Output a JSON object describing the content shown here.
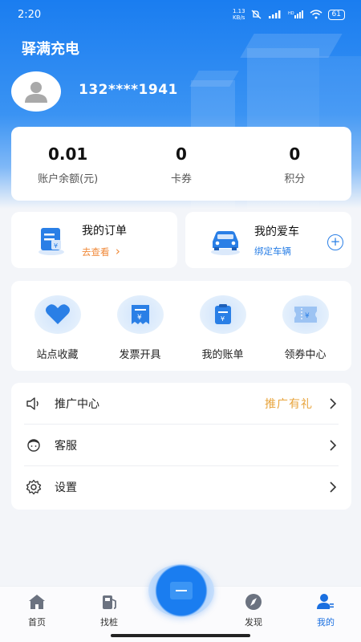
{
  "status_bar": {
    "time": "2:20",
    "net_speed_top": "1.13",
    "net_speed_bottom": "KB/s",
    "battery": "61"
  },
  "header": {
    "app_title": "驿满充电",
    "phone": "132****1941"
  },
  "stats": [
    {
      "value": "0.01",
      "label": "账户余额(元)"
    },
    {
      "value": "0",
      "label": "卡券"
    },
    {
      "value": "0",
      "label": "积分"
    }
  ],
  "quick_cards": {
    "orders": {
      "title": "我的订单",
      "sub": "去查看",
      "arrow": "›"
    },
    "car": {
      "title": "我的爱车",
      "sub": "绑定车辆",
      "plus": "+"
    }
  },
  "grid": [
    {
      "label": "站点收藏",
      "icon": "heart-icon"
    },
    {
      "label": "发票开具",
      "icon": "invoice-icon"
    },
    {
      "label": "我的账单",
      "icon": "bill-icon"
    },
    {
      "label": "领券中心",
      "icon": "coupon-icon"
    }
  ],
  "menu": [
    {
      "label": "推广中心",
      "extra": "推广有礼",
      "icon": "speaker-icon"
    },
    {
      "label": "客服",
      "extra": "",
      "icon": "headset-icon"
    },
    {
      "label": "设置",
      "extra": "",
      "icon": "gear-icon"
    }
  ],
  "tabbar": [
    {
      "label": "首页",
      "icon": "home-icon"
    },
    {
      "label": "找桩",
      "icon": "charging-station-icon"
    },
    {
      "label": "发现",
      "icon": "compass-icon"
    },
    {
      "label": "我的",
      "icon": "user-icon",
      "active": true
    }
  ],
  "colors": {
    "primary": "#1a7df0",
    "accent_orange": "#f08a3a",
    "promo_gold": "#e8a43c"
  }
}
